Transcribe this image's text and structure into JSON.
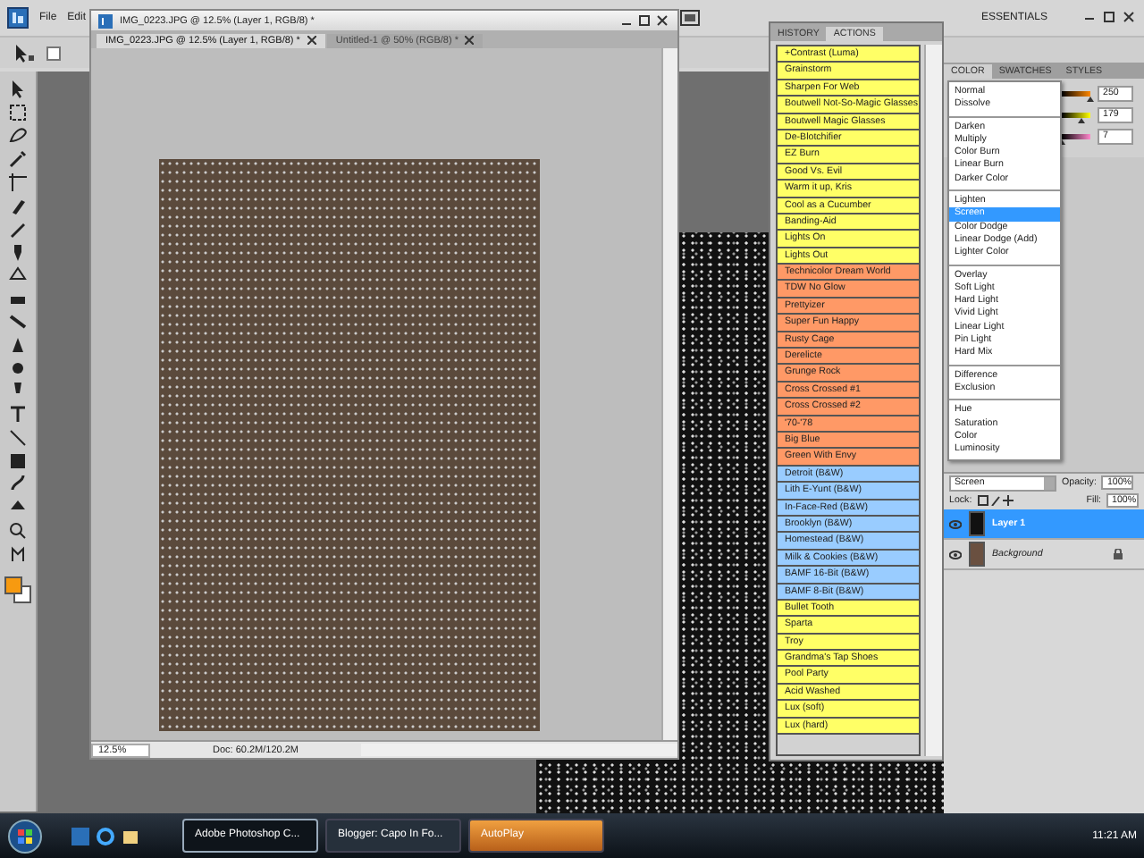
{
  "menu_bar": {
    "items": [
      "File",
      "Edit"
    ],
    "workspace": "ESSENTIALS"
  },
  "options_bar": {
    "checkbox_checked": false
  },
  "document_window": {
    "title": "IMG_0223.JPG @ 12.5% (Layer 1, RGB/8) *",
    "tabs": [
      {
        "label": "IMG_0223.JPG @ 12.5% (Layer 1, RGB/8) *",
        "selected": true
      },
      {
        "label": "Untitled-1 @ 50% (RGB/8) *",
        "selected": false
      }
    ],
    "zoom": "12.5%",
    "doc_info": "Doc: 60.2M/120.2M"
  },
  "actions_panel": {
    "tabs": [
      {
        "label": "HISTORY",
        "selected": false
      },
      {
        "label": "ACTIONS",
        "selected": true
      }
    ],
    "items": [
      {
        "label": "+Contrast (Luma)",
        "color": "#ffff66"
      },
      {
        "label": "Grainstorm",
        "color": "#ffff66"
      },
      {
        "label": "Sharpen For Web",
        "color": "#ffff66"
      },
      {
        "label": "Boutwell Not-So-Magic Glasses",
        "color": "#ffff66"
      },
      {
        "label": "Boutwell Magic Glasses",
        "color": "#ffff66"
      },
      {
        "label": "De-Blotchifier",
        "color": "#ffff66"
      },
      {
        "label": "EZ Burn",
        "color": "#ffff66"
      },
      {
        "label": "Good Vs. Evil",
        "color": "#ffff66"
      },
      {
        "label": "Warm it up, Kris",
        "color": "#ffff66"
      },
      {
        "label": "Cool as a Cucumber",
        "color": "#ffff66"
      },
      {
        "label": "Banding-Aid",
        "color": "#ffff66"
      },
      {
        "label": "Lights On",
        "color": "#ffff66"
      },
      {
        "label": "Lights Out",
        "color": "#ffff66"
      },
      {
        "label": "Technicolor Dream World",
        "color": "#ff9966"
      },
      {
        "label": "TDW No Glow",
        "color": "#ff9966"
      },
      {
        "label": "Prettyizer",
        "color": "#ff9966"
      },
      {
        "label": "Super Fun Happy",
        "color": "#ff9966"
      },
      {
        "label": "Rusty Cage",
        "color": "#ff9966"
      },
      {
        "label": "Derelicte",
        "color": "#ff9966"
      },
      {
        "label": "Grunge Rock",
        "color": "#ff9966"
      },
      {
        "label": "Cross Crossed #1",
        "color": "#ff9966"
      },
      {
        "label": "Cross Crossed #2",
        "color": "#ff9966"
      },
      {
        "label": "'70-'78",
        "color": "#ff9966"
      },
      {
        "label": "Big Blue",
        "color": "#ff9966"
      },
      {
        "label": "Green With Envy",
        "color": "#ff9966"
      },
      {
        "label": "Detroit (B&W)",
        "color": "#99ccff"
      },
      {
        "label": "Lith E-Yunt (B&W)",
        "color": "#99ccff"
      },
      {
        "label": "In-Face-Red (B&W)",
        "color": "#99ccff"
      },
      {
        "label": "Brooklyn (B&W)",
        "color": "#99ccff"
      },
      {
        "label": "Homestead (B&W)",
        "color": "#99ccff"
      },
      {
        "label": "Milk & Cookies (B&W)",
        "color": "#99ccff"
      },
      {
        "label": "BAMF 16-Bit (B&W)",
        "color": "#99ccff"
      },
      {
        "label": "BAMF 8-Bit (B&W)",
        "color": "#99ccff"
      },
      {
        "label": "Bullet Tooth",
        "color": "#ffff66"
      },
      {
        "label": "Sparta",
        "color": "#ffff66"
      },
      {
        "label": "Troy",
        "color": "#ffff66"
      },
      {
        "label": "Grandma's Tap Shoes",
        "color": "#ffff66"
      },
      {
        "label": "Pool Party",
        "color": "#ffff66"
      },
      {
        "label": "Acid Washed",
        "color": "#ffff66"
      },
      {
        "label": "Lux (soft)",
        "color": "#ffff66"
      },
      {
        "label": "Lux (hard)",
        "color": "#ffff66"
      }
    ]
  },
  "color_panel": {
    "tabs": [
      {
        "label": "COLOR",
        "selected": true
      },
      {
        "label": "SWATCHES",
        "selected": false
      },
      {
        "label": "STYLES",
        "selected": false
      }
    ],
    "sliders": [
      {
        "value": "250",
        "level": 0.98
      },
      {
        "value": "179",
        "level": 0.7
      },
      {
        "value": "7",
        "level": 0.03
      }
    ]
  },
  "blend_menu": {
    "groups": [
      [
        {
          "label": "Normal",
          "selected": false
        },
        {
          "label": "Dissolve",
          "selected": false
        }
      ],
      [
        {
          "label": "Darken",
          "selected": false
        },
        {
          "label": "Multiply",
          "selected": false
        },
        {
          "label": "Color Burn",
          "selected": false
        },
        {
          "label": "Linear Burn",
          "selected": false
        },
        {
          "label": "Darker Color",
          "selected": false
        }
      ],
      [
        {
          "label": "Lighten",
          "selected": false
        },
        {
          "label": "Screen",
          "selected": true
        },
        {
          "label": "Color Dodge",
          "selected": false
        },
        {
          "label": "Linear Dodge (Add)",
          "selected": false
        },
        {
          "label": "Lighter Color",
          "selected": false
        }
      ],
      [
        {
          "label": "Overlay",
          "selected": false
        },
        {
          "label": "Soft Light",
          "selected": false
        },
        {
          "label": "Hard Light",
          "selected": false
        },
        {
          "label": "Vivid Light",
          "selected": false
        },
        {
          "label": "Linear Light",
          "selected": false
        },
        {
          "label": "Pin Light",
          "selected": false
        },
        {
          "label": "Hard Mix",
          "selected": false
        }
      ],
      [
        {
          "label": "Difference",
          "selected": false
        },
        {
          "label": "Exclusion",
          "selected": false
        }
      ],
      [
        {
          "label": "Hue",
          "selected": false
        },
        {
          "label": "Saturation",
          "selected": false
        },
        {
          "label": "Color",
          "selected": false
        },
        {
          "label": "Luminosity",
          "selected": false
        }
      ]
    ]
  },
  "layers_panel": {
    "blend_mode": "Screen",
    "opacity_label": "Opacity:",
    "opacity": "100%",
    "lock_label": "Lock:",
    "fill_label": "Fill:",
    "fill": "100%",
    "layers": [
      {
        "name": "Layer 1",
        "kind": "normal",
        "selected": true
      },
      {
        "name": "Background",
        "kind": "background",
        "selected": false
      }
    ]
  },
  "taskbar": {
    "items": [
      {
        "label": "Adobe Photoshop C...",
        "selected": true,
        "flashing": false
      },
      {
        "label": "Blogger: Capo In Fo...",
        "selected": false,
        "flashing": false
      },
      {
        "label": "AutoPlay",
        "selected": false,
        "flashing": true
      }
    ],
    "clock": "11:21 AM"
  }
}
